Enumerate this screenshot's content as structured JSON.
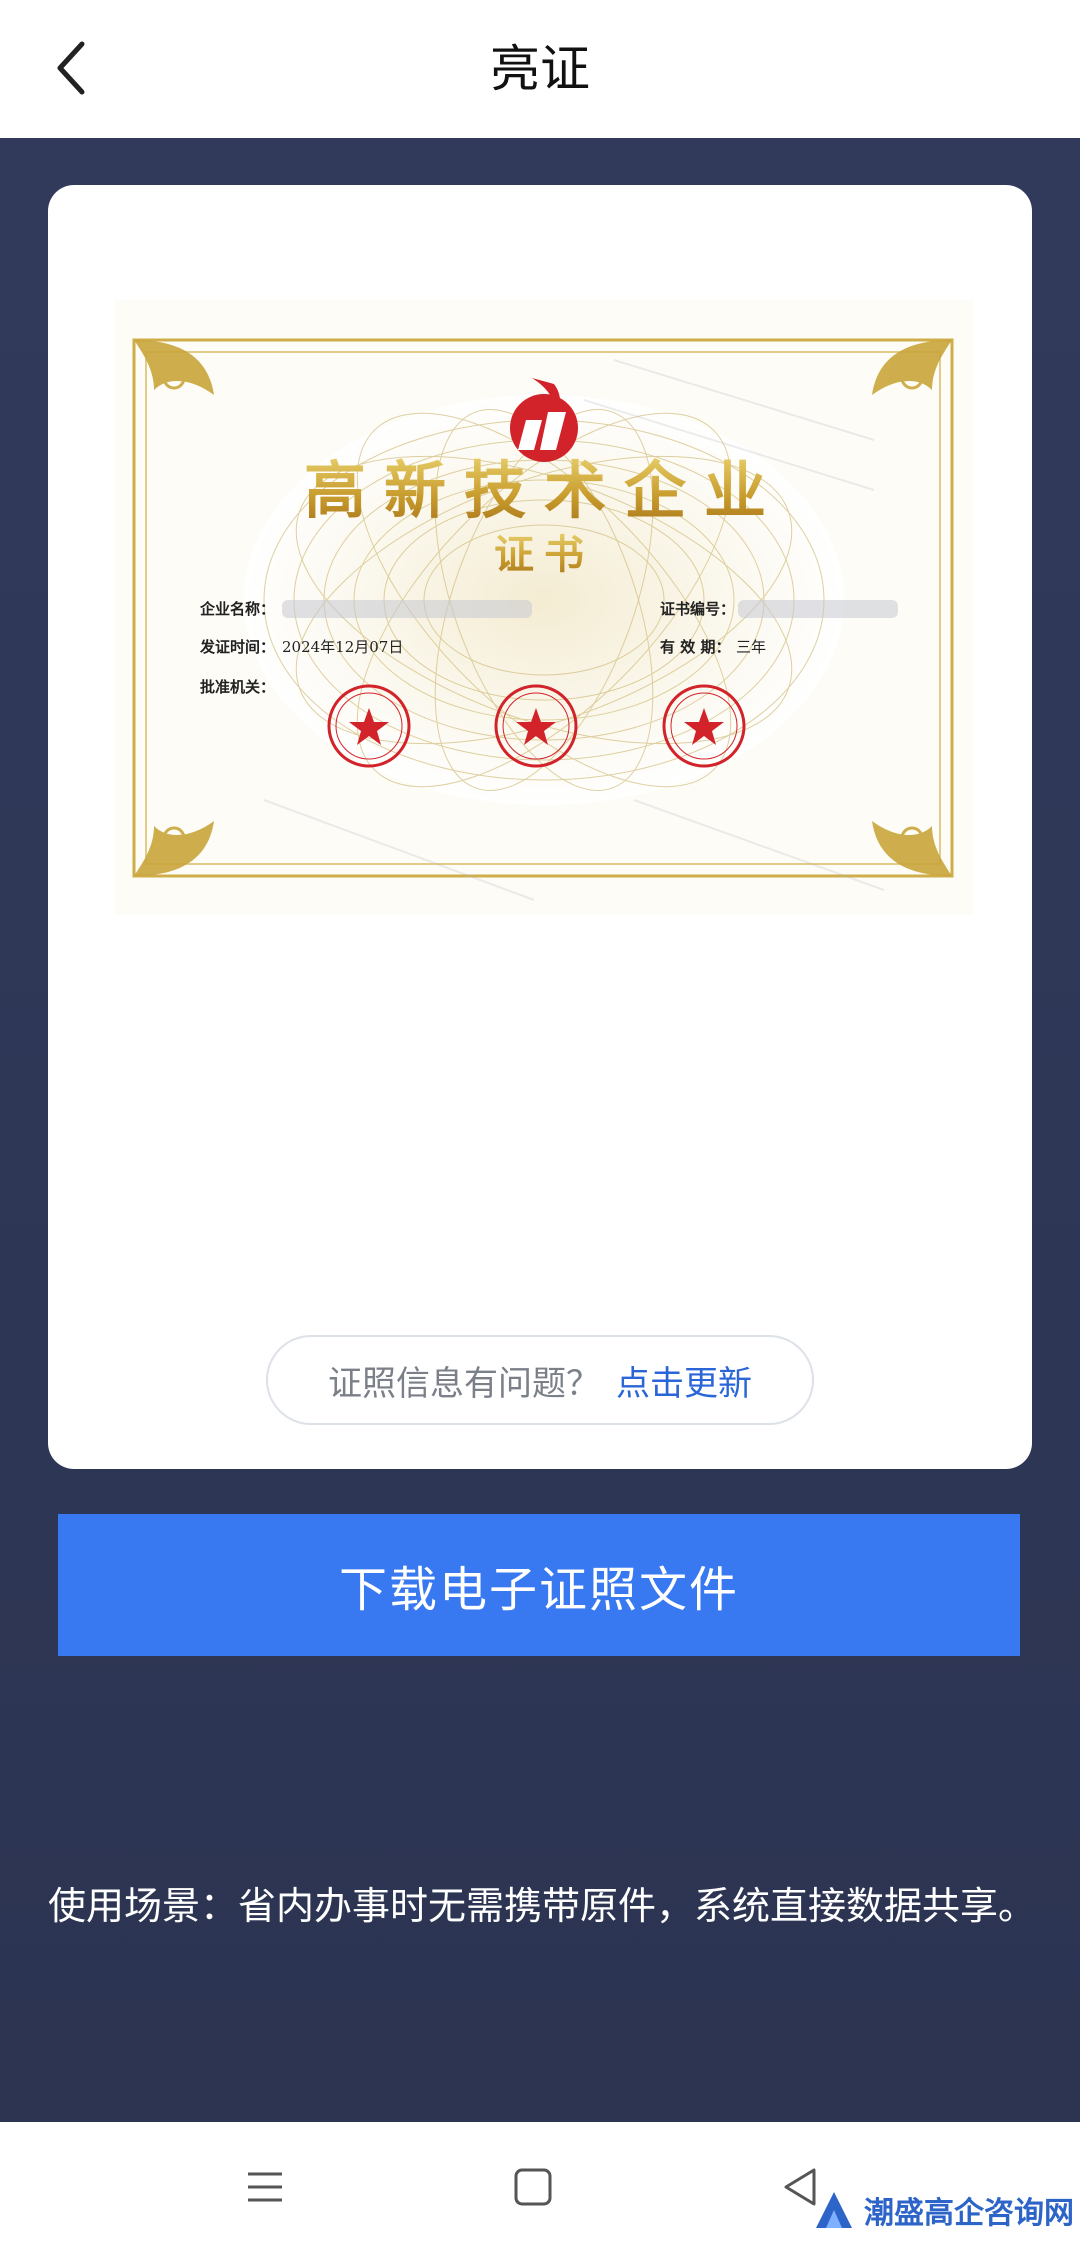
{
  "header": {
    "title": "亮证"
  },
  "certificate": {
    "main_title": "高新技术企业",
    "sub_title": "证书",
    "company_label": "企业名称：",
    "cert_no_label": "证书编号：",
    "issue_label": "发证时间：",
    "issue_date": "2024年12月07日",
    "validity_label": "有 效 期：",
    "validity_value": "三年",
    "authority_label": "批准机关："
  },
  "card": {
    "info_question": "证照信息有问题？",
    "info_link": "点击更新"
  },
  "download_label": "下载电子证照文件",
  "usage_text": "使用场景：省内办事时无需携带原件，系统直接数据共享。",
  "watermark": "潮盛高企咨询网",
  "colors": {
    "background": "#2d3655",
    "accent": "#3878f0",
    "link": "#2a66d8",
    "gold": "#c9a53a",
    "seal_red": "#d2232a"
  }
}
